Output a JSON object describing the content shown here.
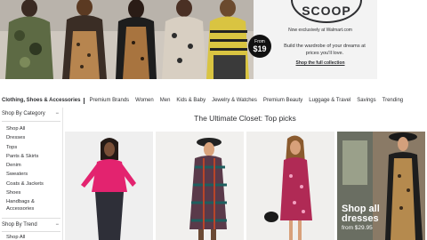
{
  "hero": {
    "brand": "SCOOP",
    "exclusive": "Now exclusively at Walmart.com",
    "badge_from": "From",
    "badge_price": "$19",
    "description": "Build the wardrobe of your dreams at prices you'll love.",
    "link": "Shop the full collection"
  },
  "nav": {
    "active": "Clothing, Shoes & Accessories",
    "items": [
      "Premium Brands",
      "Women",
      "Men",
      "Kids & Baby",
      "Jewelry & Watches",
      "Premium Beauty",
      "Luggage & Travel",
      "Savings",
      "Trending"
    ]
  },
  "sidebar": {
    "category_heading": "Shop By Category",
    "toggle": "−",
    "categories": [
      "Shop All",
      "Dresses",
      "Tops",
      "Pants & Skirts",
      "Denim",
      "Sweaters",
      "Coats & Jackets",
      "Shoes"
    ],
    "category_multi_line": [
      "Handbags &",
      "Accessories"
    ],
    "trend_heading": "Shop By Trend",
    "trend_items": [
      "Shop All"
    ]
  },
  "content": {
    "title": "The Ultimate Closet: Top picks",
    "promo_big_1": "Shop all",
    "promo_big_2": "dresses",
    "promo_small": "from $29.95"
  },
  "colors": {
    "text": "#2e2f32",
    "badge": "#111111",
    "panel": "#f3f3f3"
  }
}
